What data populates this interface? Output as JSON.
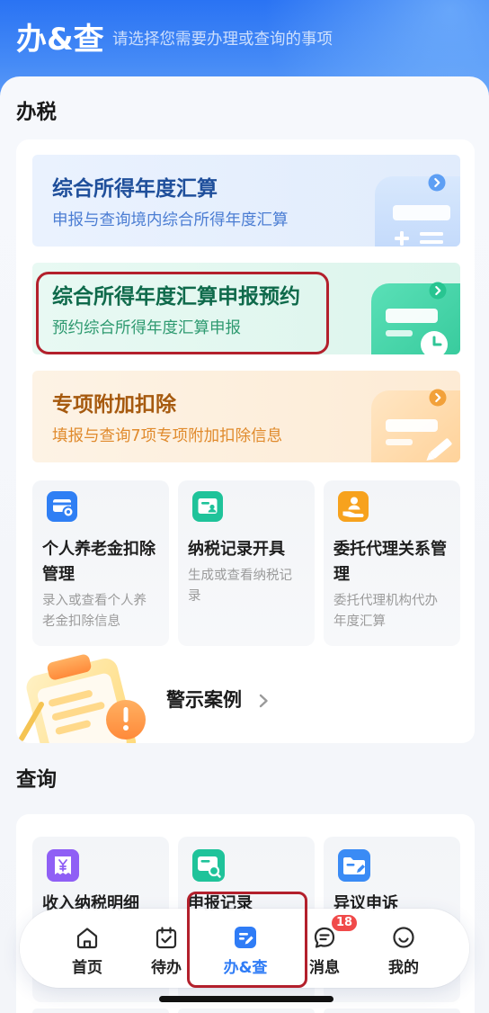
{
  "header": {
    "title": "办&查",
    "subtitle": "请选择您需要办理或查询的事项"
  },
  "tax": {
    "heading": "办税",
    "banners": [
      {
        "title": "综合所得年度汇算",
        "subtitle": "申报与查询境内综合所得年度汇算",
        "icon": "calculator-illustration",
        "accent": "#1f4f9b"
      },
      {
        "title": "综合所得年度汇算申报预约",
        "subtitle": "预约综合所得年度汇算申报",
        "icon": "appointment-clock-illustration",
        "accent": "#0f6a4b"
      },
      {
        "title": "专项附加扣除",
        "subtitle": "填报与查询7项专项附加扣除信息",
        "icon": "form-pencil-illustration",
        "accent": "#a65a0f"
      }
    ],
    "services": [
      {
        "title": "个人养老金扣除管理",
        "desc": "录入或查看个人养老金扣除信息",
        "icon": "pension-card-icon",
        "color": "#2f7ff4"
      },
      {
        "title": "纳税记录开具",
        "desc": "生成或查看纳税记录",
        "icon": "tax-record-icon",
        "color": "#1fc39a"
      },
      {
        "title": "委托代理关系管理",
        "desc": "委托代理机构代办年度汇算",
        "icon": "agent-hand-icon",
        "color": "#f7a21d"
      }
    ],
    "warning": {
      "label": "警示案例",
      "icon": "warning-clipboard-illustration"
    }
  },
  "query": {
    "heading": "查询",
    "services": [
      {
        "title": "收入纳税明细",
        "icon": "income-receipt-icon",
        "color": "#8f5ff5"
      },
      {
        "title": "申报记录",
        "icon": "declaration-search-icon",
        "color": "#1fc39a"
      },
      {
        "title": "异议申诉",
        "icon": "appeal-folder-icon",
        "color": "#3a8bf5"
      }
    ]
  },
  "tab_bar": {
    "items": [
      {
        "label": "首页",
        "icon": "home-icon",
        "active": false
      },
      {
        "label": "待办",
        "icon": "todo-calendar-icon",
        "active": false
      },
      {
        "label": "办&查",
        "icon": "handle-query-icon",
        "active": true
      },
      {
        "label": "消息",
        "icon": "message-icon",
        "active": false,
        "badge": "18"
      },
      {
        "label": "我的",
        "icon": "profile-smile-icon",
        "active": false
      }
    ]
  },
  "colors": {
    "brand": "#2f7cf6",
    "badge": "#f04a4a",
    "annotation_highlight": "#b3202c"
  }
}
